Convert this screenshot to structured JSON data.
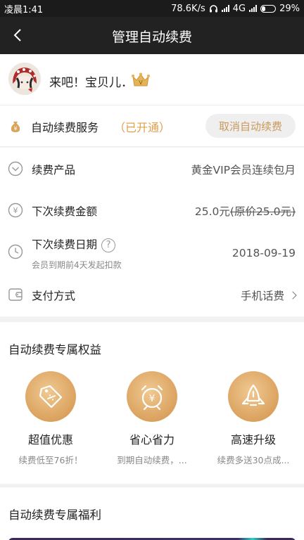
{
  "statusbar": {
    "time": "凌晨1:41",
    "speed": "78.6K/s",
    "network": "4G",
    "battery": "29%",
    "battery_level": 0.29
  },
  "header": {
    "title": "管理自动续费"
  },
  "user": {
    "name": "来吧！宝贝儿．"
  },
  "service": {
    "label": "自动续费服务",
    "status": "（已开通）",
    "cancel_label": "取消自动续费"
  },
  "details": {
    "product_label": "续费产品",
    "product_value": "黄金VIP会员连续包月",
    "amount_label": "下次续费金额",
    "amount_value": "25.0元",
    "amount_original": "(原价25.0元)",
    "date_label": "下次续费日期",
    "date_note": "会员到期前4天发起扣款",
    "date_value": "2018-09-19",
    "payment_label": "支付方式",
    "payment_value": "手机话费"
  },
  "benefits": {
    "title": "自动续费专属权益",
    "items": [
      {
        "name": "超值优惠",
        "desc": "续费低至76折！"
      },
      {
        "name": "省心省力",
        "desc": "到期自动续费，..."
      },
      {
        "name": "高速升级",
        "desc": "续费多送30点成..."
      }
    ]
  },
  "welfare": {
    "title": "自动续费专属福利"
  },
  "colors": {
    "accent": "#e0a04a",
    "gold": "#d99f5a",
    "nav": "#222222"
  }
}
